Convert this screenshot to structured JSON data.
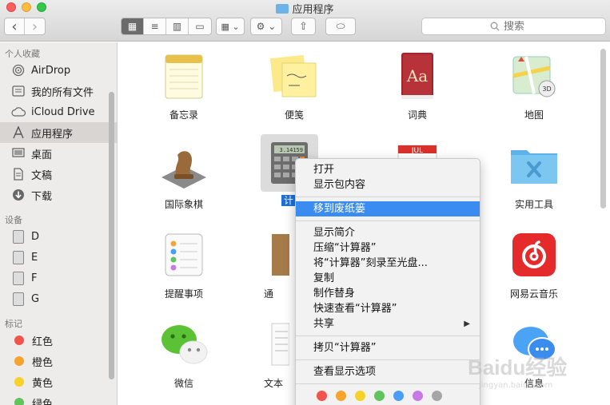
{
  "window": {
    "title": "应用程序"
  },
  "toolbar": {
    "back": "‹",
    "forward": "›",
    "view_icon": "▦",
    "view_list": "≡",
    "view_column": "▥",
    "view_cover": "▭",
    "arrange": "▦ ⌄",
    "action": "⚙ ⌄",
    "share": "⇧",
    "tag": "⬭",
    "search_placeholder": "搜索"
  },
  "sidebar": {
    "favorites_title": "个人收藏",
    "favorites": [
      {
        "label": "AirDrop",
        "icon": "airdrop-icon"
      },
      {
        "label": "我的所有文件",
        "icon": "all-files-icon"
      },
      {
        "label": "iCloud Drive",
        "icon": "cloud-icon"
      },
      {
        "label": "应用程序",
        "icon": "applications-icon",
        "selected": true
      },
      {
        "label": "桌面",
        "icon": "desktop-icon"
      },
      {
        "label": "文稿",
        "icon": "documents-icon"
      },
      {
        "label": "下载",
        "icon": "downloads-icon"
      }
    ],
    "devices_title": "设备",
    "devices": [
      "D",
      "E",
      "F",
      "G"
    ],
    "tags_title": "标记",
    "tags": [
      {
        "label": "红色",
        "color": "#f2534b"
      },
      {
        "label": "橙色",
        "color": "#f7a32e"
      },
      {
        "label": "黄色",
        "color": "#f5d12a"
      },
      {
        "label": "绿色",
        "color": "#5fc45b"
      }
    ]
  },
  "apps": [
    {
      "label": "备忘录",
      "icon": "notes-icon"
    },
    {
      "label": "便笺",
      "icon": "stickies-icon"
    },
    {
      "label": "词典",
      "icon": "dictionary-icon"
    },
    {
      "label": "地图",
      "icon": "maps-icon"
    },
    {
      "label": "国际象棋",
      "icon": "chess-icon"
    },
    {
      "label": "计",
      "icon": "calculator-icon"
    },
    {
      "label": "",
      "icon": "calendar-icon"
    },
    {
      "label": "实用工具",
      "icon": "utilities-folder-icon"
    },
    {
      "label": "提醒事项",
      "icon": "reminders-icon"
    },
    {
      "label": "通",
      "icon": "contacts-icon"
    },
    {
      "label": "",
      "icon": "hidden-icon"
    },
    {
      "label": "网易云音乐",
      "icon": "netease-music-icon"
    },
    {
      "label": "微信",
      "icon": "wechat-icon"
    },
    {
      "label": "文本",
      "icon": "textedit-icon"
    },
    {
      "label": "",
      "icon": "hidden-icon"
    },
    {
      "label": "信息",
      "icon": "messages-icon"
    }
  ],
  "calendar_month": "JUL",
  "calculator_display": "3.14159",
  "context_menu": {
    "items": [
      {
        "label": "打开"
      },
      {
        "label": "显示包内容"
      },
      {
        "sep": true
      },
      {
        "label": "移到废纸篓",
        "highlighted": true
      },
      {
        "sep": true
      },
      {
        "label": "显示简介"
      },
      {
        "label": "压缩“计算器”"
      },
      {
        "label": "将“计算器”刻录至光盘..."
      },
      {
        "label": "复制"
      },
      {
        "label": "制作替身"
      },
      {
        "label": "快速查看“计算器”"
      },
      {
        "label": "共享",
        "submenu": true
      },
      {
        "sep": true
      },
      {
        "label": "拷贝“计算器”"
      },
      {
        "sep": true
      },
      {
        "label": "查看显示选项"
      },
      {
        "sep": true
      }
    ],
    "tag_colors": [
      "#f2534b",
      "#f7a32e",
      "#f5d12a",
      "#5fc45b",
      "#4a9ff5",
      "#c879e8",
      "#a6a6a6"
    ]
  },
  "watermark": {
    "text": "Baidu经验",
    "sub": "jingyan.baidu.com"
  }
}
